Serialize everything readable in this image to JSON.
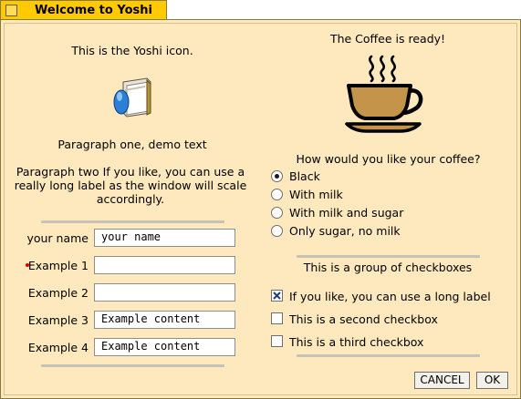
{
  "window": {
    "title": "Welcome to Yoshi"
  },
  "left": {
    "icon_caption": "This is the Yoshi icon.",
    "icon": "yoshi-icon",
    "paragraph_one": "Paragraph one, demo text",
    "paragraph_two_lines": [
      "Paragraph two  If you like, you can use a",
      "really long label  as the window will scale",
      "accordingly."
    ],
    "form": [
      {
        "label": "your name",
        "value": "your name",
        "required": false
      },
      {
        "label": "Example 1",
        "value": "",
        "required": true
      },
      {
        "label": "Example 2",
        "value": "",
        "required": false
      },
      {
        "label": "Example 3",
        "value": "Example content",
        "required": false
      },
      {
        "label": "Example 4",
        "value": "Example content",
        "required": false
      }
    ]
  },
  "right": {
    "coffee_caption": "The Coffee is ready!",
    "coffee_icon": "coffee-cup-icon",
    "question": "How would you like your coffee?",
    "radios": [
      {
        "label": "Black",
        "selected": true
      },
      {
        "label": "With milk",
        "selected": false
      },
      {
        "label": "With milk and sugar",
        "selected": false
      },
      {
        "label": "Only sugar, no milk",
        "selected": false
      }
    ],
    "checkbox_group_title": "This is a group of checkboxes",
    "checkboxes": [
      {
        "label": "If you like, you can use a long label",
        "checked": true
      },
      {
        "label": "This is a second checkbox",
        "checked": false
      },
      {
        "label": "This is a third checkbox",
        "checked": false
      }
    ]
  },
  "buttons": {
    "cancel": "CANCEL",
    "ok": "OK"
  },
  "colors": {
    "title_tab": "#ffcb00",
    "panel": "#fde9bd",
    "coffee": "#c4944a",
    "check_mark": "#1f3f7a"
  }
}
